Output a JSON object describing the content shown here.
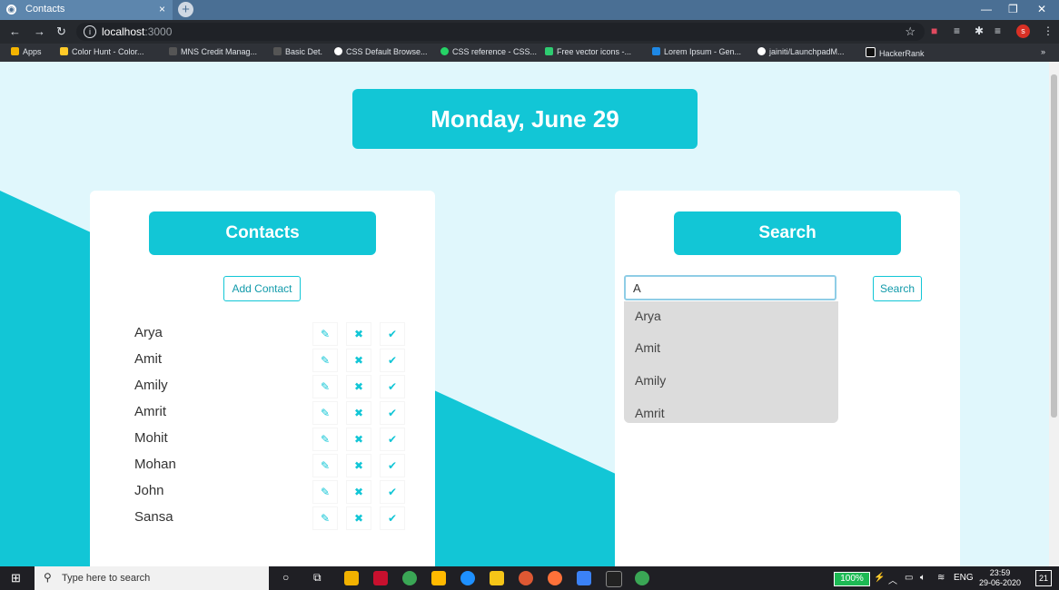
{
  "browser": {
    "tab_title": "Contacts",
    "tab_close": "×",
    "new_tab": "+",
    "url_host": "localhost",
    "url_port": ":3000",
    "bookmarks": [
      "Apps",
      "Color Hunt - Color...",
      "MNS Credit Manag...",
      "Basic Det.",
      "CSS Default Browse...",
      "CSS reference - CSS...",
      "Free vector icons -...",
      "Lorem Ipsum - Gen...",
      "jainiti/LaunchpadM...",
      "HackerRank"
    ]
  },
  "page": {
    "date": "Monday, June 29",
    "accent_color": "#12c6d6"
  },
  "contacts": {
    "title": "Contacts",
    "add_button": "Add Contact",
    "items": [
      {
        "name": "Arya"
      },
      {
        "name": "Amit"
      },
      {
        "name": "Amily"
      },
      {
        "name": "Amrit"
      },
      {
        "name": "Mohit"
      },
      {
        "name": "Mohan"
      },
      {
        "name": "John"
      },
      {
        "name": "Sansa"
      }
    ],
    "action_icons": [
      "user-edit-icon",
      "user-remove-icon",
      "check-circle-icon"
    ]
  },
  "search": {
    "title": "Search",
    "input_value": "A",
    "button": "Search",
    "suggestions": [
      "Arya",
      "Amit",
      "Amily",
      "Amrit"
    ]
  },
  "taskbar": {
    "search_placeholder": "Type here to search",
    "battery": "100%",
    "language": "ENG",
    "time": "23:59",
    "date": "29-06-2020",
    "notifications": "21"
  }
}
